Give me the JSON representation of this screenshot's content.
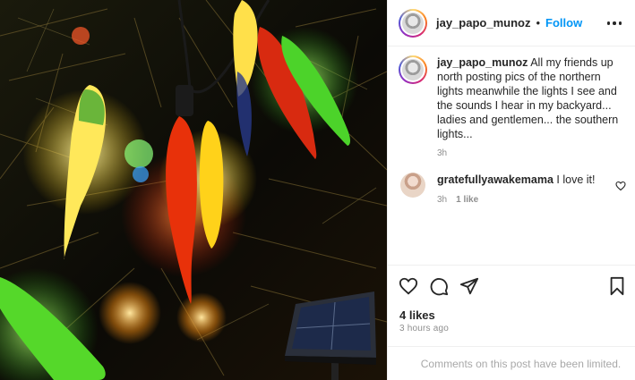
{
  "post": {
    "username": "jay_papo_munoz",
    "separator": "•",
    "follow_label": "Follow",
    "more_icon": "more-horizontal-icon"
  },
  "caption": {
    "username": "jay_papo_munoz",
    "text": "All my friends up north posting pics of the northern lights meanwhile the lights I see and the sounds I hear in my backyard... ladies and gentlemen... the southern lights...",
    "time": "3h"
  },
  "comments": [
    {
      "username": "gratefullyawakemama",
      "text": "I love it!",
      "time": "3h",
      "likes": "1 like"
    }
  ],
  "actions": {
    "like_icon": "heart-icon",
    "comment_icon": "comment-icon",
    "share_icon": "send-icon",
    "save_icon": "bookmark-icon"
  },
  "stats": {
    "likes": "4 likes",
    "time_ago": "3 hours ago"
  },
  "footer": {
    "limited_text": "Comments on this post have been limited."
  },
  "colors": {
    "accent": "#0095f6",
    "muted": "#8e8e8e",
    "text": "#262626"
  }
}
